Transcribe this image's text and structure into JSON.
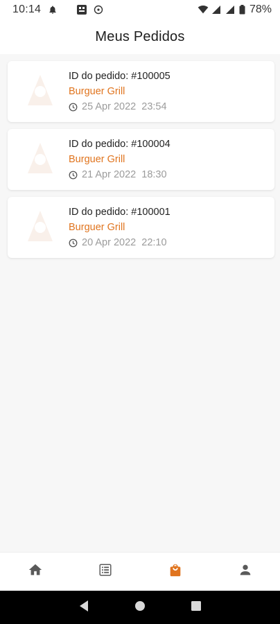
{
  "status_bar": {
    "time": "10:14",
    "battery": "78%"
  },
  "app_bar": {
    "title": "Meus Pedidos"
  },
  "orders": [
    {
      "id_label": "ID do pedido:",
      "order_id": "#100005",
      "restaurant": "Burguer Grill",
      "datetime": "25 Apr 2022  23:54"
    },
    {
      "id_label": "ID do pedido:",
      "order_id": "#100004",
      "restaurant": "Burguer Grill",
      "datetime": "21 Apr 2022  18:30"
    },
    {
      "id_label": "ID do pedido:",
      "order_id": "#100001",
      "restaurant": "Burguer Grill",
      "datetime": "20 Apr 2022  22:10"
    }
  ],
  "bottom_nav": {
    "items": [
      {
        "icon": "home-icon",
        "active": false
      },
      {
        "icon": "list-icon",
        "active": false
      },
      {
        "icon": "shopping-bag-icon",
        "active": true
      },
      {
        "icon": "user-icon",
        "active": false
      }
    ]
  },
  "colors": {
    "accent": "#e0741e",
    "inactive_icon": "#555555",
    "muted_text": "#9b9b9b"
  }
}
